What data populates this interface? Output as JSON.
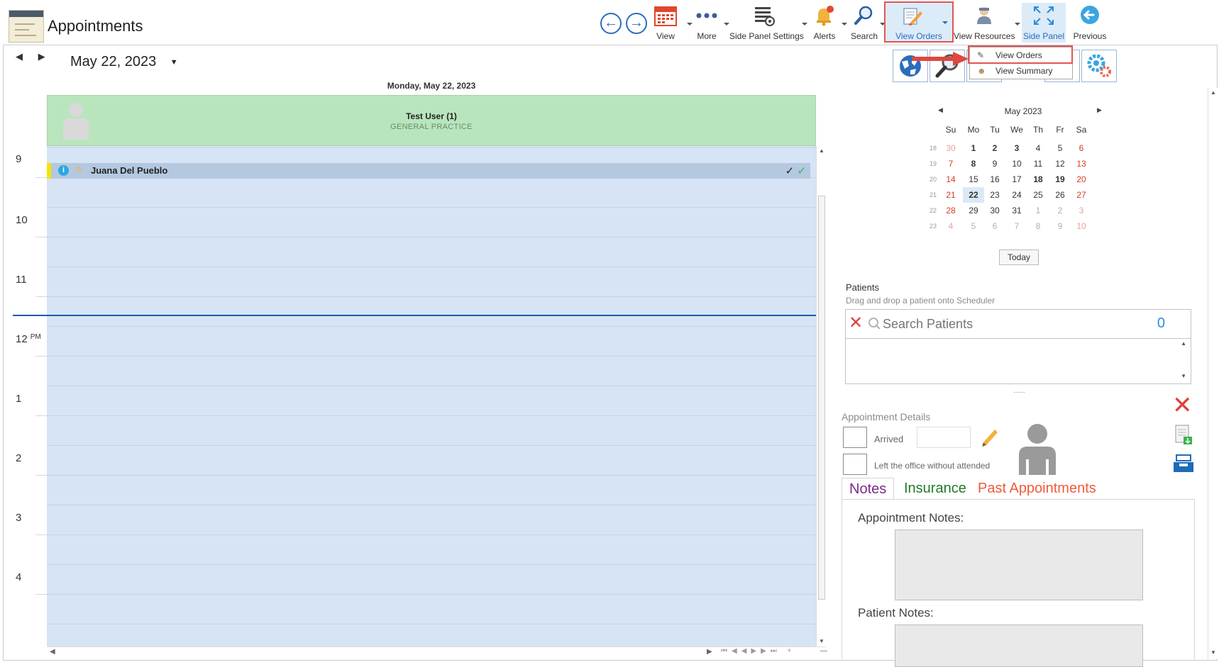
{
  "header": {
    "title": "Appointments",
    "toolbar": {
      "view": "View",
      "more": "More",
      "side_panel_settings": "Side Panel Settings",
      "alerts": "Alerts",
      "search": "Search",
      "view_orders": "View Orders",
      "view_resources": "View Resources",
      "side_panel": "Side Panel",
      "previous": "Previous"
    }
  },
  "dropdown": {
    "items": [
      "View Orders",
      "View Summary"
    ]
  },
  "scheduler": {
    "date": "May 22, 2023",
    "day_header": "Monday, May 22, 2023",
    "resource_name": "Test User (1)",
    "resource_sub": "GENERAL PRACTICE",
    "hours": [
      "9",
      "10",
      "11",
      "12",
      "1",
      "2",
      "3",
      "4"
    ],
    "pm_label": "PM",
    "appointment": {
      "patient": "Juana Del Pueblo",
      "info": "i",
      "check1": "✓",
      "check2": "✓"
    }
  },
  "calendar": {
    "title": "May 2023",
    "weekdays": [
      "Su",
      "Mo",
      "Tu",
      "We",
      "Th",
      "Fr",
      "Sa"
    ],
    "weeks": [
      {
        "wk": "18",
        "days": [
          "30",
          "1",
          "2",
          "3",
          "4",
          "5",
          "6"
        ]
      },
      {
        "wk": "19",
        "days": [
          "7",
          "8",
          "9",
          "10",
          "11",
          "12",
          "13"
        ]
      },
      {
        "wk": "20",
        "days": [
          "14",
          "15",
          "16",
          "17",
          "18",
          "19",
          "20"
        ]
      },
      {
        "wk": "21",
        "days": [
          "21",
          "22",
          "23",
          "24",
          "25",
          "26",
          "27"
        ]
      },
      {
        "wk": "22",
        "days": [
          "28",
          "29",
          "30",
          "31",
          "1",
          "2",
          "3"
        ]
      },
      {
        "wk": "23",
        "days": [
          "4",
          "5",
          "6",
          "7",
          "8",
          "9",
          "10"
        ]
      }
    ],
    "selected_day": "22",
    "today_label": "Today"
  },
  "patients": {
    "title": "Patients",
    "subtitle": "Drag and drop a patient onto Scheduler",
    "search_placeholder": "Search Patients",
    "count": "0"
  },
  "appointment_details": {
    "title": "Appointment Details",
    "arrived_label": "Arrived",
    "left_label": "Left the office without attended",
    "tabs": [
      "Notes",
      "Insurance",
      "Past Appointments"
    ],
    "appointment_notes_label": "Appointment Notes:",
    "patient_notes_label": "Patient Notes:"
  },
  "colors": {
    "accent_blue": "#2a6ebb",
    "highlight_red": "#e35454",
    "resource_green": "#b9e5bc",
    "grid_blue": "#d6e4f5",
    "tab_notes": "#7a2a8a",
    "tab_insurance": "#1f7a2a",
    "tab_past": "#f05a3a"
  }
}
